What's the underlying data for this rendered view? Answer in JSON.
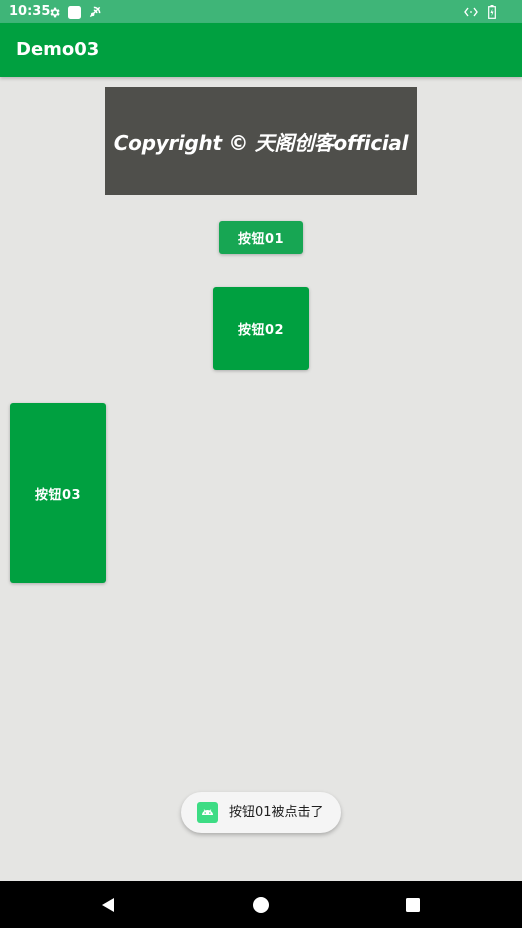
{
  "status_bar": {
    "time": "10:35",
    "icons_left": [
      "gear-icon",
      "square-notification-icon",
      "wifi-signal-icon"
    ],
    "icons_right": [
      "code-arrows-icon",
      "battery-icon"
    ]
  },
  "app_bar": {
    "title": "Demo03"
  },
  "banner": {
    "text": "Copyright © 天阁创客official"
  },
  "buttons": {
    "btn01_label": "按钮01",
    "btn02_label": "按钮02",
    "btn03_label": "按钮03"
  },
  "toast": {
    "icon": "android-icon",
    "message": "按钮01被点击了"
  },
  "nav_bar": {
    "icons": [
      "back-triangle-icon",
      "home-circle-icon",
      "recents-square-icon"
    ]
  },
  "colors": {
    "primary": "#00a040",
    "status_bar": "#3fb578",
    "background": "#e5e5e3",
    "banner_background": "#4f4f4b",
    "toast_icon": "#3ddc84"
  }
}
